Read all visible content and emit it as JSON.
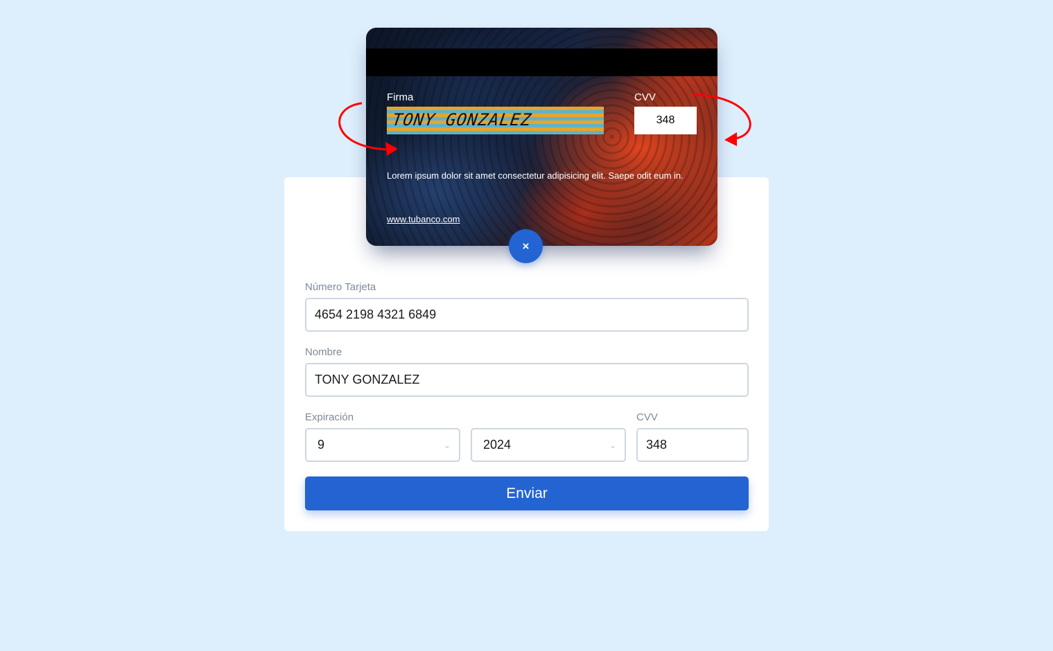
{
  "card": {
    "signature_label": "Firma",
    "cvv_label": "CVV",
    "signature_value": "TONY GONZALEZ",
    "cvv_value": "348",
    "legend": "Lorem ipsum dolor sit amet consectetur adipisicing elit. Saepe odit eum in.",
    "url": "www.tubanco.com"
  },
  "close_button": {
    "icon": "close-icon",
    "glyph": "×"
  },
  "form": {
    "card_number_label": "Número Tarjeta",
    "card_number_value": "4654 2198 4321 6849",
    "name_label": "Nombre",
    "name_value": "TONY GONZALEZ",
    "expiration_label": "Expiración",
    "month_value": "9",
    "year_value": "2024",
    "cvv_label": "CVV",
    "cvv_value": "348",
    "submit_label": "Enviar"
  },
  "colors": {
    "background": "#ddeefc",
    "accent": "#2364d2",
    "arrow": "#ff0000"
  }
}
